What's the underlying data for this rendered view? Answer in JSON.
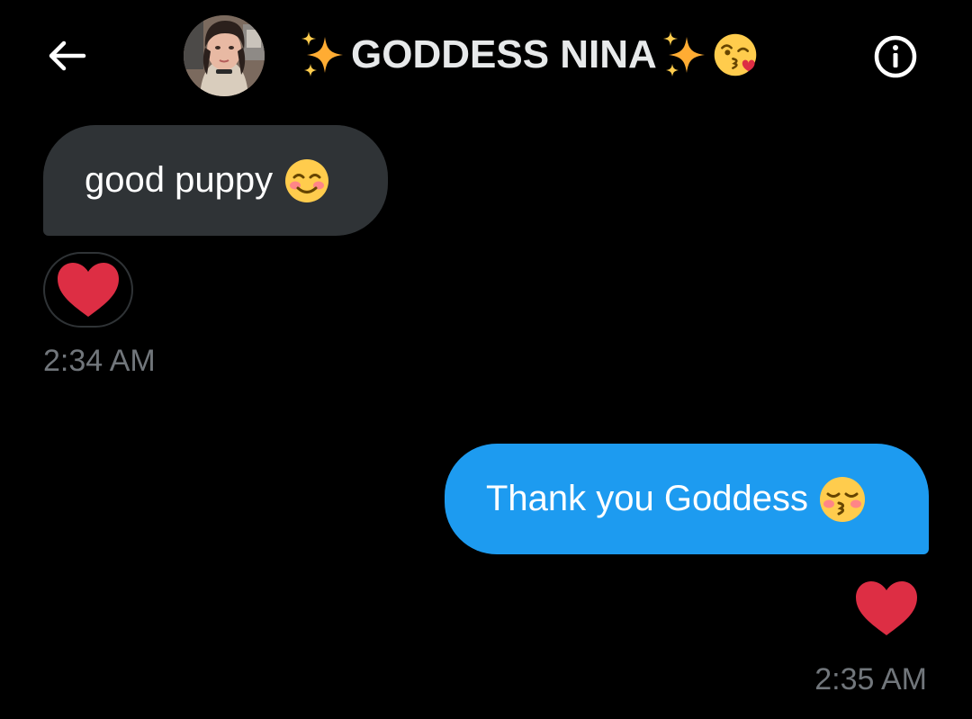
{
  "header": {
    "back_icon": "arrow-left-icon",
    "title": "GODDESS NINA",
    "title_decorations": [
      "sparkles-emoji",
      "sparkles-emoji",
      "face-blowing-kiss-emoji"
    ],
    "info_icon": "info-circle-icon",
    "avatar": "contact-avatar-photo"
  },
  "messages": [
    {
      "direction": "incoming",
      "text": "good puppy",
      "emoji": "smiling-face-emoji",
      "reaction": "red-heart-emoji",
      "time": "2:34 AM"
    },
    {
      "direction": "outgoing",
      "text": "Thank you Goddess",
      "emoji": "kissing-face-with-closed-eyes-emoji",
      "reaction": "red-heart-emoji",
      "time": "2:35 AM"
    }
  ],
  "colors": {
    "background": "#000000",
    "incoming_bubble": "#2f3336",
    "outgoing_bubble": "#1d9bf0",
    "timestamp": "#71767b",
    "heart": "#dd2e44",
    "emoji_yellow": "#ffcc4d"
  }
}
